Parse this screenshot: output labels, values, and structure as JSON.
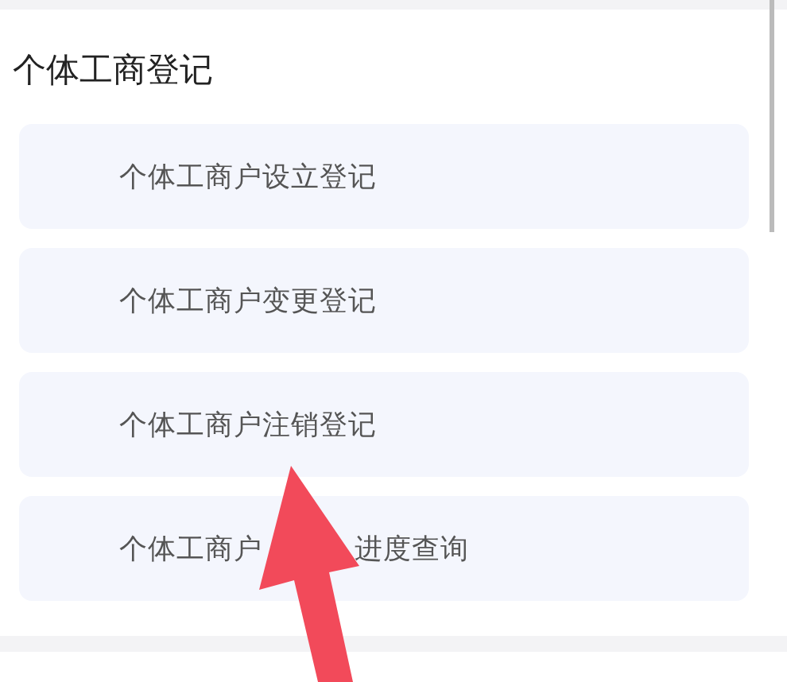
{
  "section": {
    "title": "个体工商登记",
    "items": [
      {
        "label": "个体工商户设立登记"
      },
      {
        "label": "个体工商户变更登记"
      },
      {
        "label": "个体工商户注销登记"
      },
      {
        "label": "个体工商户",
        "label_end": "进度查询"
      }
    ]
  }
}
